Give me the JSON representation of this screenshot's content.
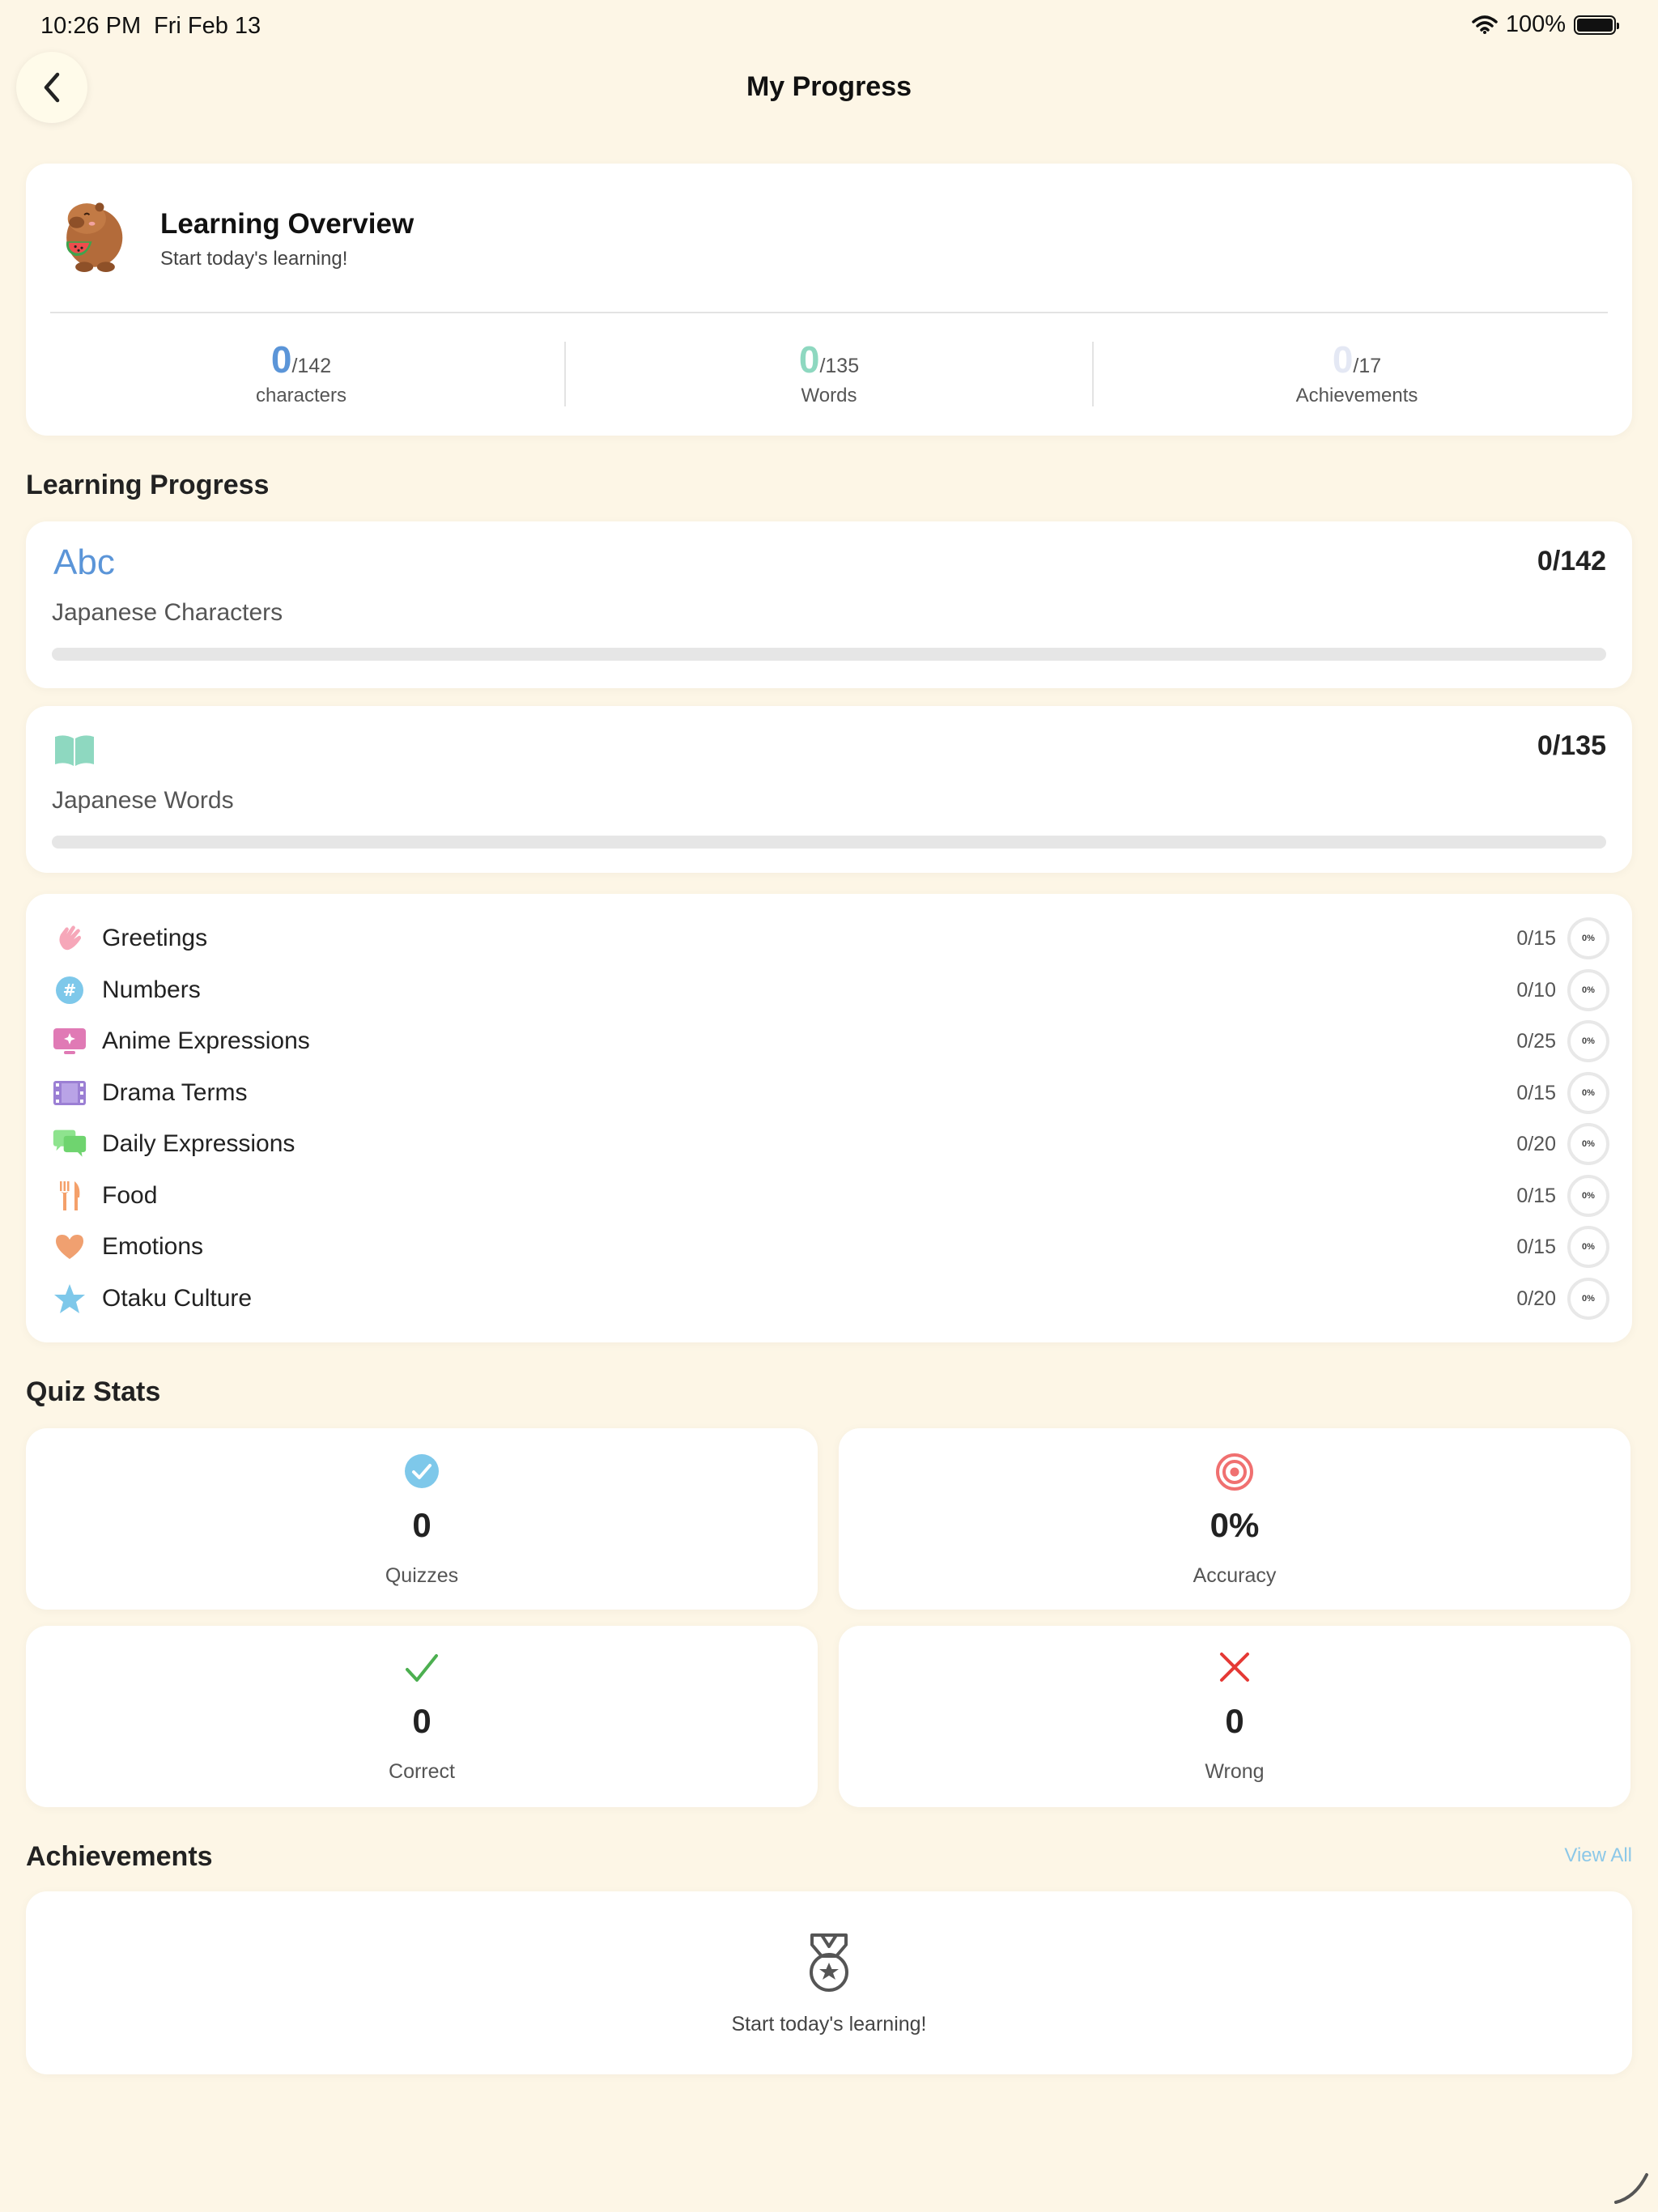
{
  "status_bar": {
    "time": "10:26 PM",
    "date": "Fri Feb 13",
    "battery": "100%"
  },
  "header": {
    "title": "My Progress"
  },
  "overview": {
    "title": "Learning Overview",
    "subtitle": "Start today's learning!",
    "stats": [
      {
        "value": "0",
        "total": "/142",
        "label": "characters",
        "color": "#5B95D8"
      },
      {
        "value": "0",
        "total": "/135",
        "label": "Words",
        "color": "#8ED8C0"
      },
      {
        "value": "0",
        "total": "/17",
        "label": "Achievements",
        "color": "#E4E8F4"
      }
    ]
  },
  "learning_progress": {
    "section_title": "Learning Progress",
    "characters": {
      "icon_text": "Abc",
      "label": "Japanese Characters",
      "count": "0/142",
      "progress": 0
    },
    "words": {
      "label": "Japanese Words",
      "count": "0/135",
      "progress": 0
    }
  },
  "categories": [
    {
      "name": "Greetings",
      "count": "0/15",
      "percent": "0%",
      "icon": "waving-hand-icon",
      "color": "#F6A7B9"
    },
    {
      "name": "Numbers",
      "count": "0/10",
      "percent": "0%",
      "icon": "number-sign-icon",
      "color": "#7EC8EA"
    },
    {
      "name": "Anime Expressions",
      "count": "0/25",
      "percent": "0%",
      "icon": "tv-sparkle-icon",
      "color": "#E07AB5"
    },
    {
      "name": "Drama Terms",
      "count": "0/15",
      "percent": "0%",
      "icon": "film-icon",
      "color": "#9B7FD4"
    },
    {
      "name": "Daily Expressions",
      "count": "0/20",
      "percent": "0%",
      "icon": "chat-bubbles-icon",
      "color": "#8EE38E"
    },
    {
      "name": "Food",
      "count": "0/15",
      "percent": "0%",
      "icon": "fork-knife-icon",
      "color": "#F4A06A"
    },
    {
      "name": "Emotions",
      "count": "0/15",
      "percent": "0%",
      "icon": "heart-icon",
      "color": "#F0A070"
    },
    {
      "name": "Otaku Culture",
      "count": "0/20",
      "percent": "0%",
      "icon": "star-icon",
      "color": "#7EC8EA"
    }
  ],
  "quiz_stats": {
    "section_title": "Quiz Stats",
    "quizzes": {
      "value": "0",
      "label": "Quizzes"
    },
    "accuracy": {
      "value": "0%",
      "label": "Accuracy"
    },
    "correct": {
      "value": "0",
      "label": "Correct"
    },
    "wrong": {
      "value": "0",
      "label": "Wrong"
    }
  },
  "achievements": {
    "section_title": "Achievements",
    "view_all": "View All",
    "empty_text": "Start today's learning!"
  }
}
